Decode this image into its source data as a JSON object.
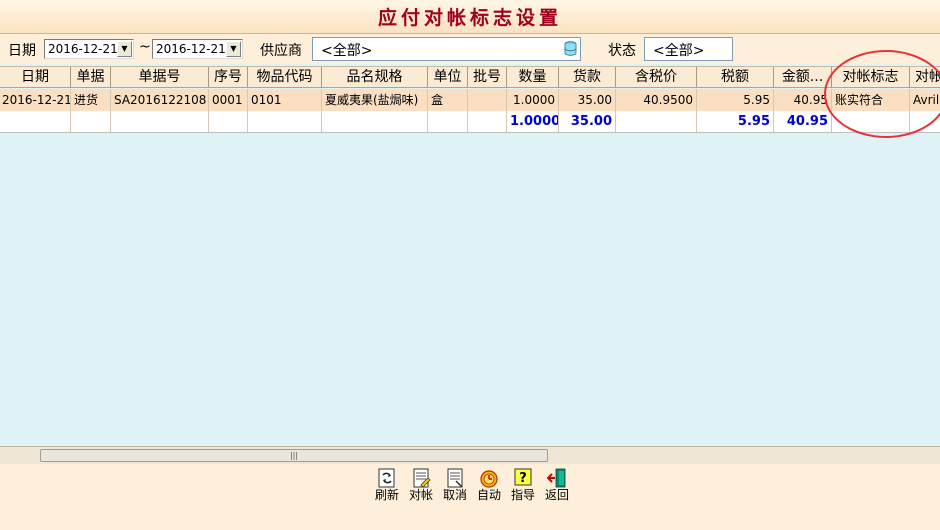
{
  "window": {
    "title": "应付对帐标志设置"
  },
  "filters": {
    "date_label": "日期",
    "date_from": "2016-12-21",
    "date_separator": "~",
    "date_to": "2016-12-21",
    "supplier_label": "供应商",
    "supplier_value": "<全部>",
    "status_label": "状态",
    "status_value": "<全部>"
  },
  "grid": {
    "columns": [
      "日期",
      "单据",
      "单据号",
      "序号",
      "物品代码",
      "品名规格",
      "单位",
      "批号",
      "数量",
      "货款",
      "含税价",
      "税额",
      "金额...",
      "对帐标志",
      "对帐"
    ],
    "rows": [
      {
        "date": "2016-12-21",
        "doc_type": "进货",
        "doc_no": "SA2016122108",
        "seq": "0001",
        "item_code": "0101",
        "item_name": "夏威夷果(盐焗味)",
        "unit": "盒",
        "batch": "",
        "qty": "1.0000",
        "goods_amount": "35.00",
        "tax_price": "40.9500",
        "tax": "5.95",
        "amount": "40.95",
        "reconcile_flag": "账实符合",
        "reconcile_by": "Avril"
      }
    ],
    "totals": {
      "qty": "1.0000",
      "goods_amount": "35.00",
      "tax": "5.95",
      "amount": "40.95"
    }
  },
  "toolbar": {
    "refresh": "刷新",
    "reconcile": "对帐",
    "cancel": "取消",
    "auto": "自动",
    "guide": "指导",
    "back": "返回"
  },
  "colors": {
    "title": "#a0001e",
    "totals": "#0000cc",
    "annotation": "#e8323a",
    "grid_background": "#dff3f7"
  }
}
